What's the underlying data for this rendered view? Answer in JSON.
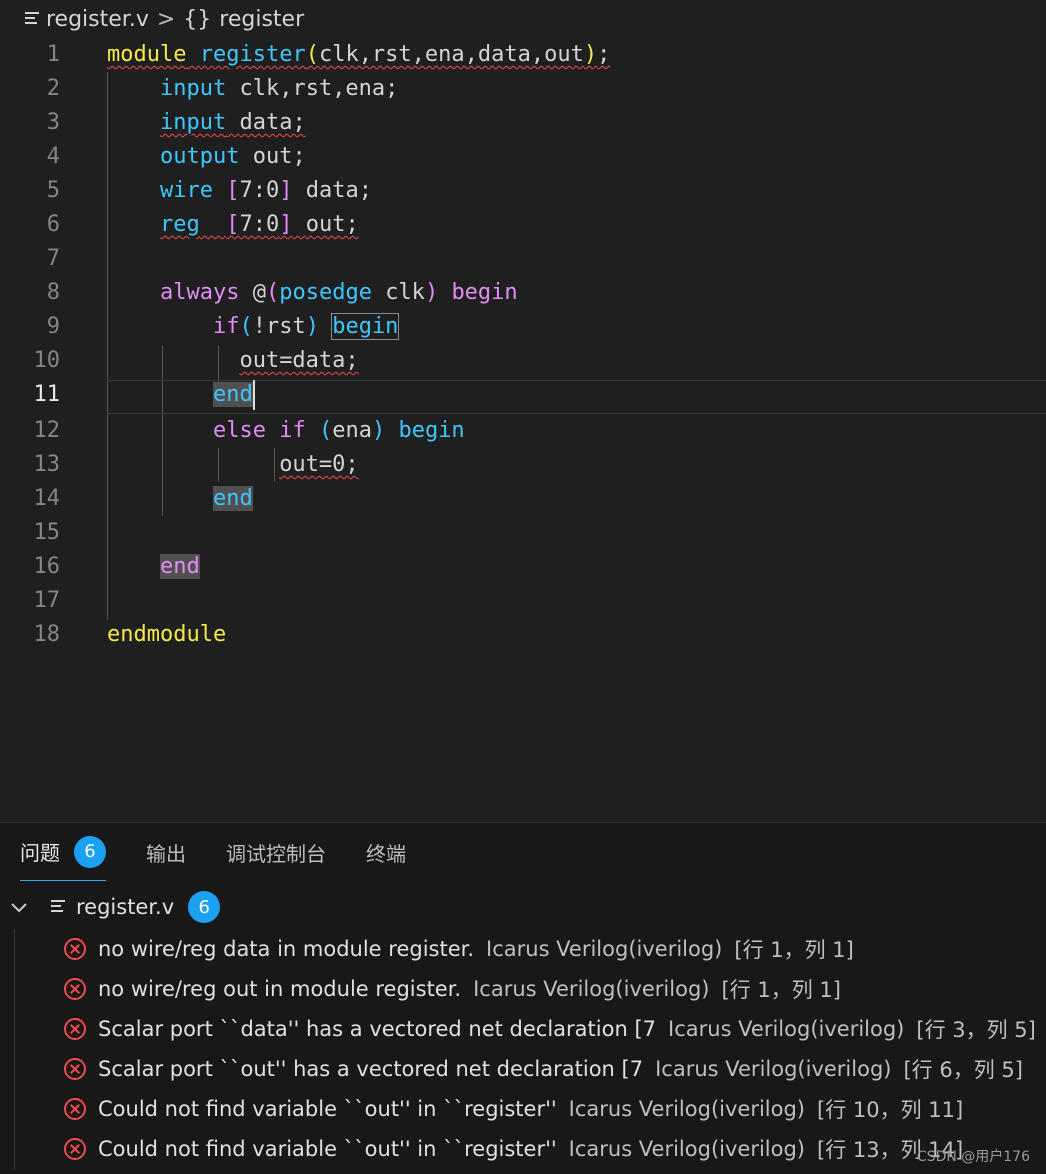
{
  "breadcrumb": {
    "file": "register.v",
    "separator": ">",
    "symbol_icon": "{}",
    "symbol": "register"
  },
  "editor": {
    "active_line": 11,
    "lines": [
      "1",
      "2",
      "3",
      "4",
      "5",
      "6",
      "7",
      "8",
      "9",
      "10",
      "11",
      "12",
      "13",
      "14",
      "15",
      "16",
      "17",
      "18"
    ]
  },
  "panel": {
    "tabs": [
      {
        "label": "问题",
        "count": "6"
      },
      {
        "label": "输出"
      },
      {
        "label": "调试控制台"
      },
      {
        "label": "终端"
      }
    ],
    "file": {
      "name": "register.v",
      "count": "6"
    },
    "problems": [
      {
        "message": "no wire/reg data in module register.",
        "source": "Icarus Verilog(iverilog)",
        "location": "[行 1，列 1]"
      },
      {
        "message": "no wire/reg out in module register.",
        "source": "Icarus Verilog(iverilog)",
        "location": "[行 1，列 1]"
      },
      {
        "message": "Scalar port ``data'' has a vectored net declaration [7",
        "source": "Icarus Verilog(iverilog)",
        "location": "[行 3，列 5]"
      },
      {
        "message": "Scalar port ``out'' has a vectored net declaration [7",
        "source": "Icarus Verilog(iverilog)",
        "location": "[行 6，列 5]"
      },
      {
        "message": "Could not find variable ``out'' in ``register''",
        "source": "Icarus Verilog(iverilog)",
        "location": "[行 10，列 11]"
      },
      {
        "message": "Could not find variable ``out'' in ``register''",
        "source": "Icarus Verilog(iverilog)",
        "location": "[行 13，列 14]"
      }
    ]
  },
  "watermark": "CSDN @用户176"
}
